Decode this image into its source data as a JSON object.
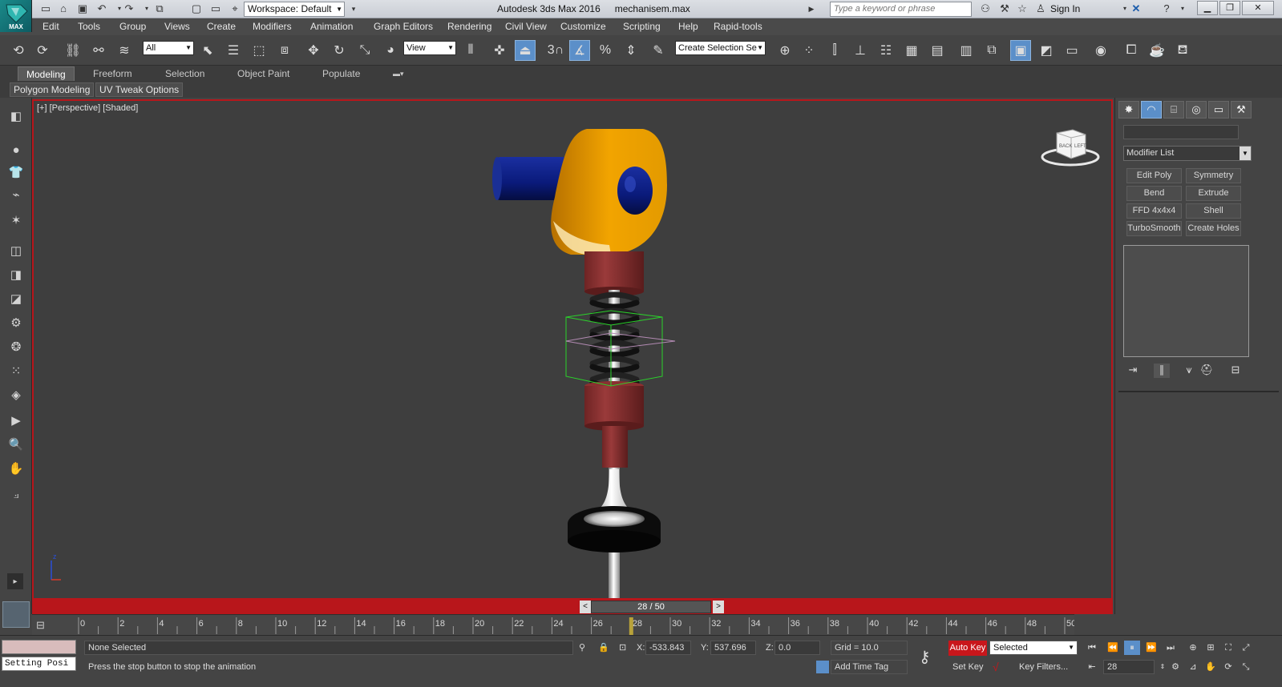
{
  "titlebar": {
    "workspace": "Workspace: Default",
    "app_name": "Autodesk 3ds Max 2016",
    "file_name": "mechanisem.max",
    "search_placeholder": "Type a keyword or phrase",
    "sign_in": "Sign In",
    "logo_text": "MAX"
  },
  "menu": [
    "Edit",
    "Tools",
    "Group",
    "Views",
    "Create",
    "Modifiers",
    "Animation",
    "Graph Editors",
    "Rendering",
    "Civil View",
    "Customize",
    "Scripting",
    "Help",
    "Rapid-tools"
  ],
  "toolbar": {
    "selection_filter": "All",
    "ref_coord": "View",
    "named_selection_placeholder": "Create Selection Se",
    "snap_value": "3"
  },
  "ribbon": {
    "tabs": [
      "Modeling",
      "Freeform",
      "Selection",
      "Object Paint",
      "Populate"
    ],
    "sub": [
      "Polygon Modeling",
      "UV Tweak Options"
    ]
  },
  "viewport": {
    "label": "[+] [Perspective] [Shaded]",
    "viewcube_faces": [
      "BACK",
      "LEFT"
    ],
    "axis_z": "z"
  },
  "command_panel": {
    "modifier_list": "Modifier List",
    "modifier_buttons": [
      "Edit Poly",
      "Symmetry",
      "Bend",
      "Extrude",
      "FFD 4x4x4",
      "Shell",
      "TurboSmooth",
      "Create Holes"
    ]
  },
  "timeline": {
    "current": "28 / 50",
    "current_frame": 28,
    "ticks": [
      "0",
      "2",
      "4",
      "6",
      "8",
      "10",
      "12",
      "14",
      "16",
      "18",
      "20",
      "22",
      "24",
      "26",
      "28",
      "30",
      "32",
      "34",
      "36",
      "38",
      "40",
      "42",
      "44",
      "46",
      "48",
      "50"
    ]
  },
  "status": {
    "listener_text": "Setting Posi",
    "selection": "None Selected",
    "prompt": "Press the stop button to stop the animation",
    "x_label": "X:",
    "x": "-533.843",
    "y_label": "Y:",
    "y": "537.696",
    "z_label": "Z:",
    "z": "0.0",
    "grid": "Grid = 10.0",
    "add_time_tag": "Add Time Tag",
    "auto_key": "Auto Key",
    "key_mode": "Selected",
    "set_key": "Set Key",
    "key_filters": "Key Filters...",
    "frame_field": "28"
  }
}
